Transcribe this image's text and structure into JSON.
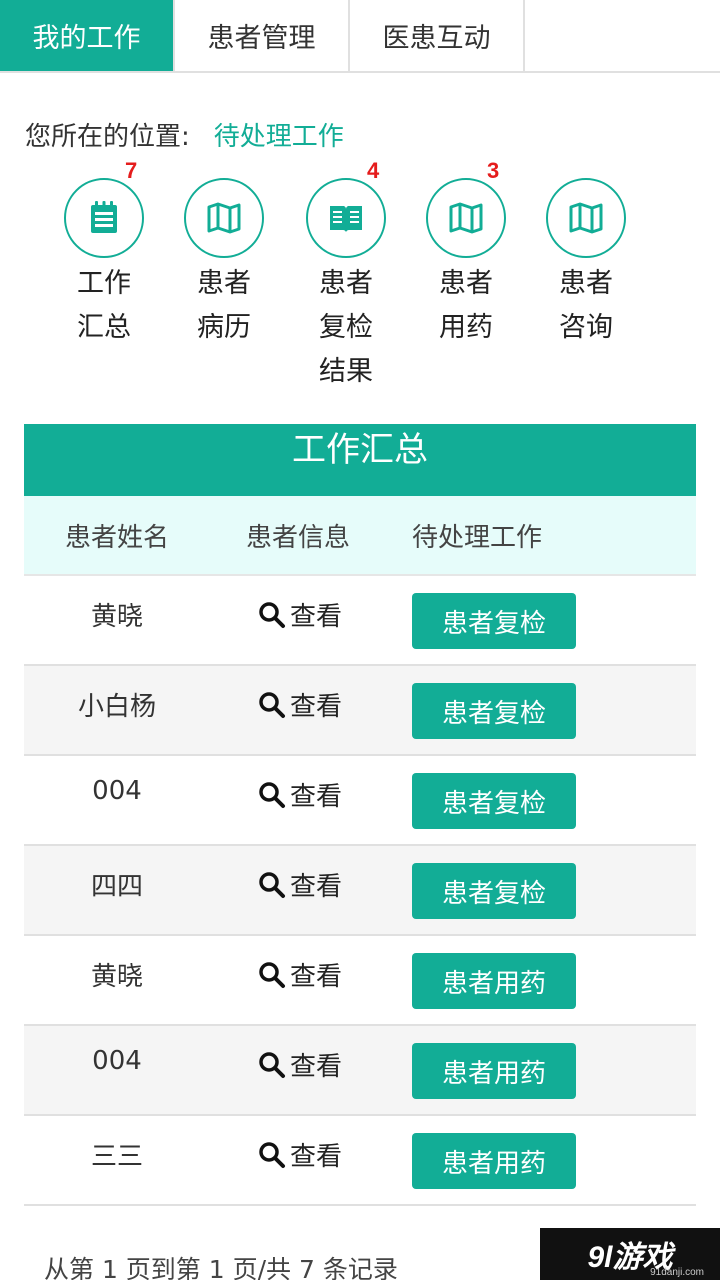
{
  "tabs": [
    {
      "label": "我的工作",
      "active": true
    },
    {
      "label": "患者管理",
      "active": false
    },
    {
      "label": "医患互动",
      "active": false
    }
  ],
  "breadcrumb": {
    "prefix": "您所在的位置:",
    "current": "待处理工作"
  },
  "shortcuts": [
    {
      "icon": "notepad-icon",
      "line1": "工作",
      "line2": "汇总",
      "line3": "",
      "badge": "7"
    },
    {
      "icon": "map-icon",
      "line1": "患者",
      "line2": "病历",
      "line3": "",
      "badge": ""
    },
    {
      "icon": "book-icon",
      "line1": "患者",
      "line2": "复检",
      "line3": "结果",
      "badge": "4"
    },
    {
      "icon": "map-icon",
      "line1": "患者",
      "line2": "用药",
      "line3": "",
      "badge": "3"
    },
    {
      "icon": "map-icon",
      "line1": "患者",
      "line2": "咨询",
      "line3": "",
      "badge": ""
    }
  ],
  "panel": {
    "title": "工作汇总",
    "columns": [
      "患者姓名",
      "患者信息",
      "待处理工作"
    ],
    "view_label": "查看",
    "rows": [
      {
        "name": "黄晓",
        "action": "患者复检"
      },
      {
        "name": "小白杨",
        "action": "患者复检"
      },
      {
        "name": "004",
        "action": "患者复检"
      },
      {
        "name": "四四",
        "action": "患者复检"
      },
      {
        "name": "黄晓",
        "action": "患者用药"
      },
      {
        "name": "004",
        "action": "患者用药"
      },
      {
        "name": "三三",
        "action": "患者用药"
      }
    ]
  },
  "pager": {
    "text": "从第 1 页到第 1 页/共 7 条记录"
  },
  "watermark": {
    "logo": "9l游戏",
    "domain": "91danji.com"
  },
  "colors": {
    "accent": "#12ad96",
    "badge": "#e51c1c",
    "header_row_bg": "#e6fcfa",
    "alt_row_bg": "#f5f5f5"
  }
}
